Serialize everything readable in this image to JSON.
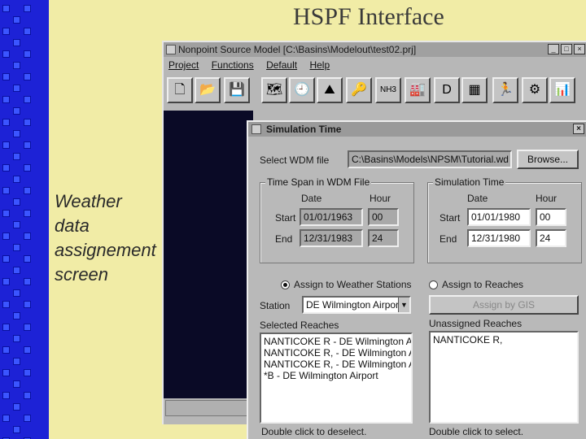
{
  "slide": {
    "title": "HSPF Interface",
    "caption": [
      "Weather",
      "data",
      "assignement",
      "screen"
    ]
  },
  "app": {
    "title": "Nonpoint Source Model   [C:\\Basins\\Modelout\\test02.prj]",
    "menu": [
      "Project",
      "Functions",
      "Default",
      "Help"
    ],
    "toolbar_icons": [
      "new-file-icon",
      "open-folder-icon",
      "save-disk-icon",
      "map-icon",
      "clock-icon",
      "landscape-icon",
      "key-icon",
      "chemistry-icon",
      "factory-icon",
      "default-icon",
      "calculator-icon",
      "runner-icon",
      "output-icon",
      "chart-icon"
    ],
    "toolbar_glyphs": [
      "🗋",
      "📂",
      "💾",
      "🗺",
      "🕘",
      "⛰",
      "🔑",
      "NH3",
      "🏭",
      "D",
      "▦",
      "🏃",
      "⚙",
      "📊"
    ]
  },
  "dialog": {
    "title": "Simulation Time",
    "select_wdm_label": "Select WDM file",
    "wdm_path": "C:\\Basins\\Models\\NPSM\\Tutorial.wd",
    "browse_label": "Browse...",
    "timespan": {
      "title": "Time Span in WDM File",
      "date_header": "Date",
      "hour_header": "Hour",
      "start_label": "Start",
      "end_label": "End",
      "start_date": "01/01/1963",
      "start_hour": "00",
      "end_date": "12/31/1983",
      "end_hour": "24"
    },
    "simtime": {
      "title": "Simulation Time",
      "date_header": "Date",
      "hour_header": "Hour",
      "start_label": "Start",
      "end_label": "End",
      "start_date": "01/01/1980",
      "start_hour": "00",
      "end_date": "12/31/1980",
      "end_hour": "24"
    },
    "assign_stations_label": "Assign to Weather Stations",
    "assign_reaches_label": "Assign to Reaches",
    "station_label": "Station",
    "station_value": "DE Wilmington Airport",
    "assign_gis_label": "Assign by GIS",
    "selected_reaches_label": "Selected Reaches",
    "selected_reaches": [
      "NANTICOKE R - DE Wilmington Air",
      "NANTICOKE R, - DE Wilmington Air",
      "NANTICOKE R, - DE Wilmington Air",
      "*B - DE Wilmington Airport"
    ],
    "unassigned_reaches_label": "Unassigned Reaches",
    "unassigned_reaches": [
      "NANTICOKE R,"
    ],
    "deselect_hint": "Double click to deselect.",
    "select_hint": "Double click to select."
  }
}
